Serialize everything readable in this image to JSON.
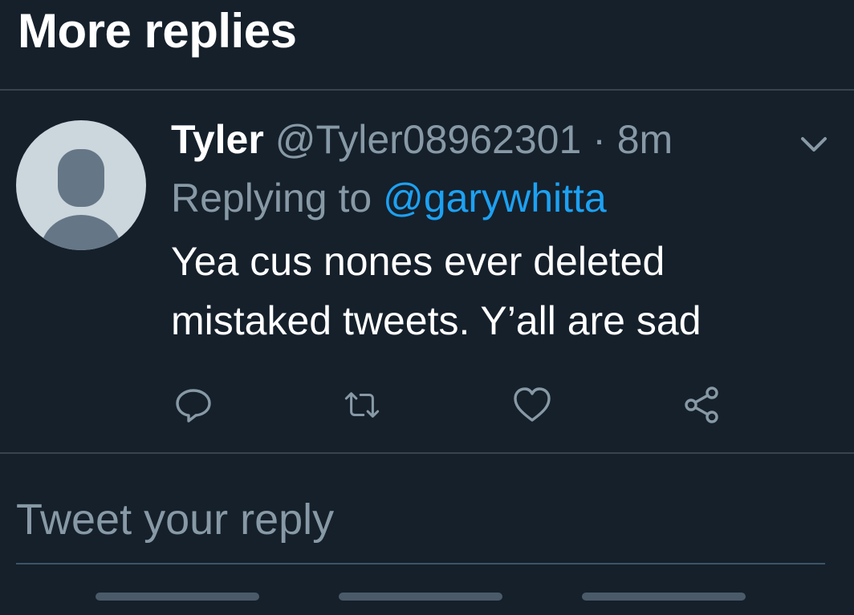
{
  "section": {
    "title": "More replies"
  },
  "tweet": {
    "display_name": "Tyler",
    "handle": "@Tyler08962301",
    "separator": "·",
    "time": "8m",
    "replying_prefix": "Replying to",
    "replying_to": "@garywhitta",
    "text_line1": "Yea cus nones ever deleted",
    "text_line2": "mistaked tweets. Y’all are sad"
  },
  "reply_box": {
    "placeholder": "Tweet your reply"
  },
  "colors": {
    "background": "#15202b",
    "divider": "#38444d",
    "secondary_text": "#8899a6",
    "accent": "#1da1f2",
    "avatar_bg": "#ccd6dd",
    "avatar_figure": "#657786"
  },
  "icons": {
    "reply": "reply-icon",
    "retweet": "retweet-icon",
    "like": "heart-icon",
    "share": "share-icon",
    "more": "chevron-down-icon",
    "avatar": "default-avatar-icon"
  }
}
